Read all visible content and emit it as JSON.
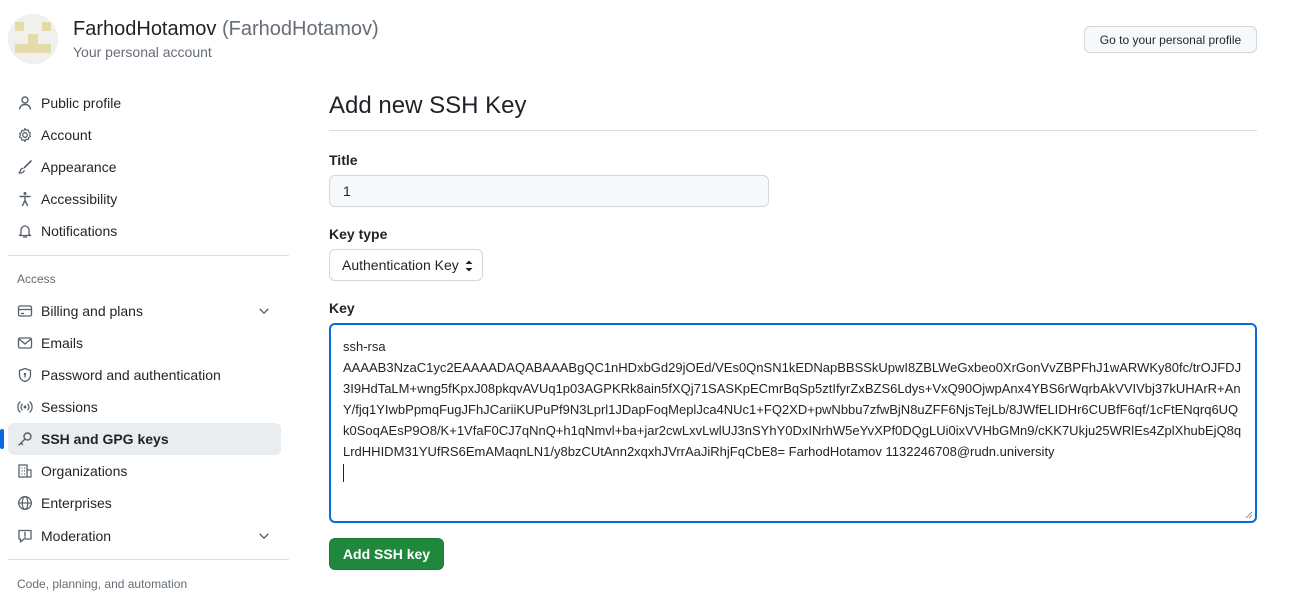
{
  "header": {
    "display_name": "FarhodHotamov",
    "handle": "(FarhodHotamov)",
    "subtitle": "Your personal account",
    "profile_button": "Go to your personal profile",
    "avatar_icon": "identicon-avatar"
  },
  "sidebar": {
    "items_top": [
      {
        "label": "Public profile",
        "icon": "person-icon"
      },
      {
        "label": "Account",
        "icon": "gear-icon"
      },
      {
        "label": "Appearance",
        "icon": "paintbrush-icon"
      },
      {
        "label": "Accessibility",
        "icon": "accessibility-icon"
      },
      {
        "label": "Notifications",
        "icon": "bell-icon"
      }
    ],
    "access_heading": "Access",
    "items_access": [
      {
        "label": "Billing and plans",
        "icon": "credit-card-icon",
        "expandable": true
      },
      {
        "label": "Emails",
        "icon": "mail-icon"
      },
      {
        "label": "Password and authentication",
        "icon": "shield-lock-icon"
      },
      {
        "label": "Sessions",
        "icon": "broadcast-icon"
      },
      {
        "label": "SSH and GPG keys",
        "icon": "key-icon",
        "active": true
      },
      {
        "label": "Organizations",
        "icon": "organization-icon"
      },
      {
        "label": "Enterprises",
        "icon": "globe-icon"
      },
      {
        "label": "Moderation",
        "icon": "report-icon",
        "expandable": true
      }
    ],
    "code_heading": "Code, planning, and automation"
  },
  "main": {
    "title": "Add new SSH Key",
    "title_label": "Title",
    "title_value": "1",
    "key_type_label": "Key type",
    "key_type_value": "Authentication Key",
    "key_label": "Key",
    "key_prefix": "ssh-rsa",
    "key_body": "AAAAB3NzaC1yc2EAAAADAQABAAABgQC1nHDxbGd29jOEd/VEs0QnSN1kEDNapBBSSkUpwI8ZBLWeGxbeo0XrGonVvZBPFhJ1wARWKy80fc/trOJFDJ3I9HdTaLM+wng5fKpxJ08pkqvAVUq1p03AGPKRk8ain5fXQj71SASKpECmrBqSp5ztIfyrZxBZS6Ldys+VxQ90OjwpAnx4YBS6rWqrbAkVVIVbj37kUHArR+AnY/fjq1YIwbPpmqFugJFhJCariiKUPuPf9N3Lprl1JDapFoqMeplJca4NUc1+FQ2XD+pwNbbu7zfwBjN8uZFF6NjsTejLb/8JWfELIDHr6CUBfF6qf/1cFtENqrq6UQk0SoqAEsP9O8/K+1VfaF0CJ7qNnQ+h1qNmvl+ba+jar2cwLxvLwlUJ3nSYhY0DxINrhW5eYvXPf0DQgLUi0ixVVHbGMn9/cKK7Ukju25WRlEs4ZplXhubEjQ8qLrdHHIDM31YUfRS6EmAMaqnLN1/y8bzCUtAnn2xqxhJVrrAaJiRhjFqCbE8= FarhodHotamov 1132246708@rudn.university",
    "submit_label": "Add SSH key"
  },
  "colors": {
    "accent": "#0969da",
    "primary_button": "#1f883d",
    "active_nav_bg": "#eaedf0"
  }
}
